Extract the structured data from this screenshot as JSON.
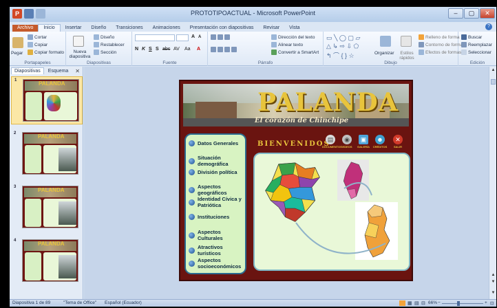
{
  "window": {
    "title": "PROTOTIPOACTUAL - Microsoft PowerPoint",
    "app_logo": "P",
    "minimize": "–",
    "maximize": "▢",
    "close": "✕"
  },
  "ribbon_tabs": [
    "Archivo",
    "Inicio",
    "Insertar",
    "Diseño",
    "Transiciones",
    "Animaciones",
    "Presentación con diapositivas",
    "Revisar",
    "Vista"
  ],
  "ribbon": {
    "clipboard": {
      "paste": "Pegar",
      "cut": "Cortar",
      "copy": "Copiar",
      "format_painter": "Copiar formato",
      "label": "Portapapeles"
    },
    "slides": {
      "new_slide": "Nueva diapositiva",
      "layout": "Diseño",
      "reset": "Restablecer",
      "section": "Sección",
      "label": "Diapositivas"
    },
    "font": {
      "label": "Fuente",
      "bold": "N",
      "italic": "K",
      "underline": "S",
      "strike": "S",
      "abc": "abc",
      "spacing": "AV",
      "case": "Aa",
      "grow": "A",
      "shrink": "A",
      "color": "A"
    },
    "paragraph": {
      "label": "Párrafo",
      "text_direction": "Dirección del texto",
      "align_text": "Alinear texto",
      "smartart": "Convertir a SmartArt"
    },
    "drawing": {
      "label": "Dibujo",
      "arrange": "Organizar",
      "quick_styles": "Estilos rápidos",
      "fill": "Relleno de forma",
      "outline": "Contorno de forma",
      "effects": "Efectos de formas"
    },
    "editing": {
      "label": "Edición",
      "find": "Buscar",
      "replace": "Reemplazar",
      "select": "Seleccionar"
    }
  },
  "left_panel": {
    "tab_slides": "Diapositivas",
    "tab_outline": "Esquema",
    "close": "✕",
    "slide_numbers": [
      "1",
      "2",
      "3",
      "4"
    ],
    "thumb_title": "PALANDA"
  },
  "slide": {
    "title": "PALANDA",
    "subtitle": "El corazón de Chinchipe",
    "welcome": "BIENVENIDOS",
    "menu": [
      "Datos Generales",
      "Situación demográfica",
      "División política",
      "Aspectos geográficos",
      "Identidad Cívica y Patriótica",
      "Instituciones",
      "Aspectos Culturales",
      "Atractivos turísticos",
      "Aspectos socioeconómicos"
    ],
    "nav_icons": [
      {
        "label": "DOCUMENTOS",
        "icon": "documents-icon",
        "color": "#d9d9d9"
      },
      {
        "label": "VIDEOS",
        "icon": "videos-icon",
        "color": "#bfbfbf"
      },
      {
        "label": "GALERÍA",
        "icon": "gallery-icon",
        "color": "#4fa3d9"
      },
      {
        "label": "CRÉDITOS",
        "icon": "credits-icon",
        "color": "#3fa0d0"
      },
      {
        "label": "SALIR",
        "icon": "exit-icon",
        "color": "#d23a2a"
      }
    ]
  },
  "statusbar": {
    "slide_info": "Diapositiva 1 de 89",
    "theme": "\"Tema de Office\"",
    "language": "Español (Ecuador)",
    "zoom": "66%"
  },
  "colors": {
    "slide_bg": "#6a1410",
    "title_gold": "#e8c43c",
    "menu_bg": "#d8f3c2",
    "map_panel_bg": "#e9f8d8",
    "ribbon_file_tab": "#c55a2b"
  }
}
